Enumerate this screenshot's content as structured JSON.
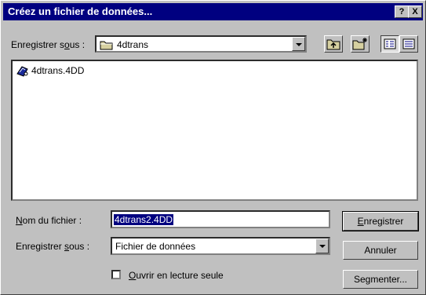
{
  "window": {
    "title": "Créez un fichier de données...",
    "help_label": "?",
    "close_label": "X"
  },
  "save_in": {
    "label_pre": "Enregistrer s",
    "label_accel": "o",
    "label_post": "us :",
    "current_folder": "4dtrans"
  },
  "files": [
    {
      "name": "4dtrans.4DD",
      "icon": "4d-database-icon"
    }
  ],
  "filename": {
    "label_accel": "N",
    "label_post": "om du fichier :",
    "value": "4dtrans2.4DD"
  },
  "save_as_type": {
    "label_pre": "Enregistrer ",
    "label_accel": "s",
    "label_post": "ous :",
    "value": "Fichier de données"
  },
  "readonly": {
    "accel": "O",
    "post": "uvrir en lecture seule",
    "checked": false
  },
  "buttons": {
    "save_accel": "E",
    "save_post": "nregistrer",
    "cancel": "Annuler",
    "segment": "Segmenter..."
  }
}
